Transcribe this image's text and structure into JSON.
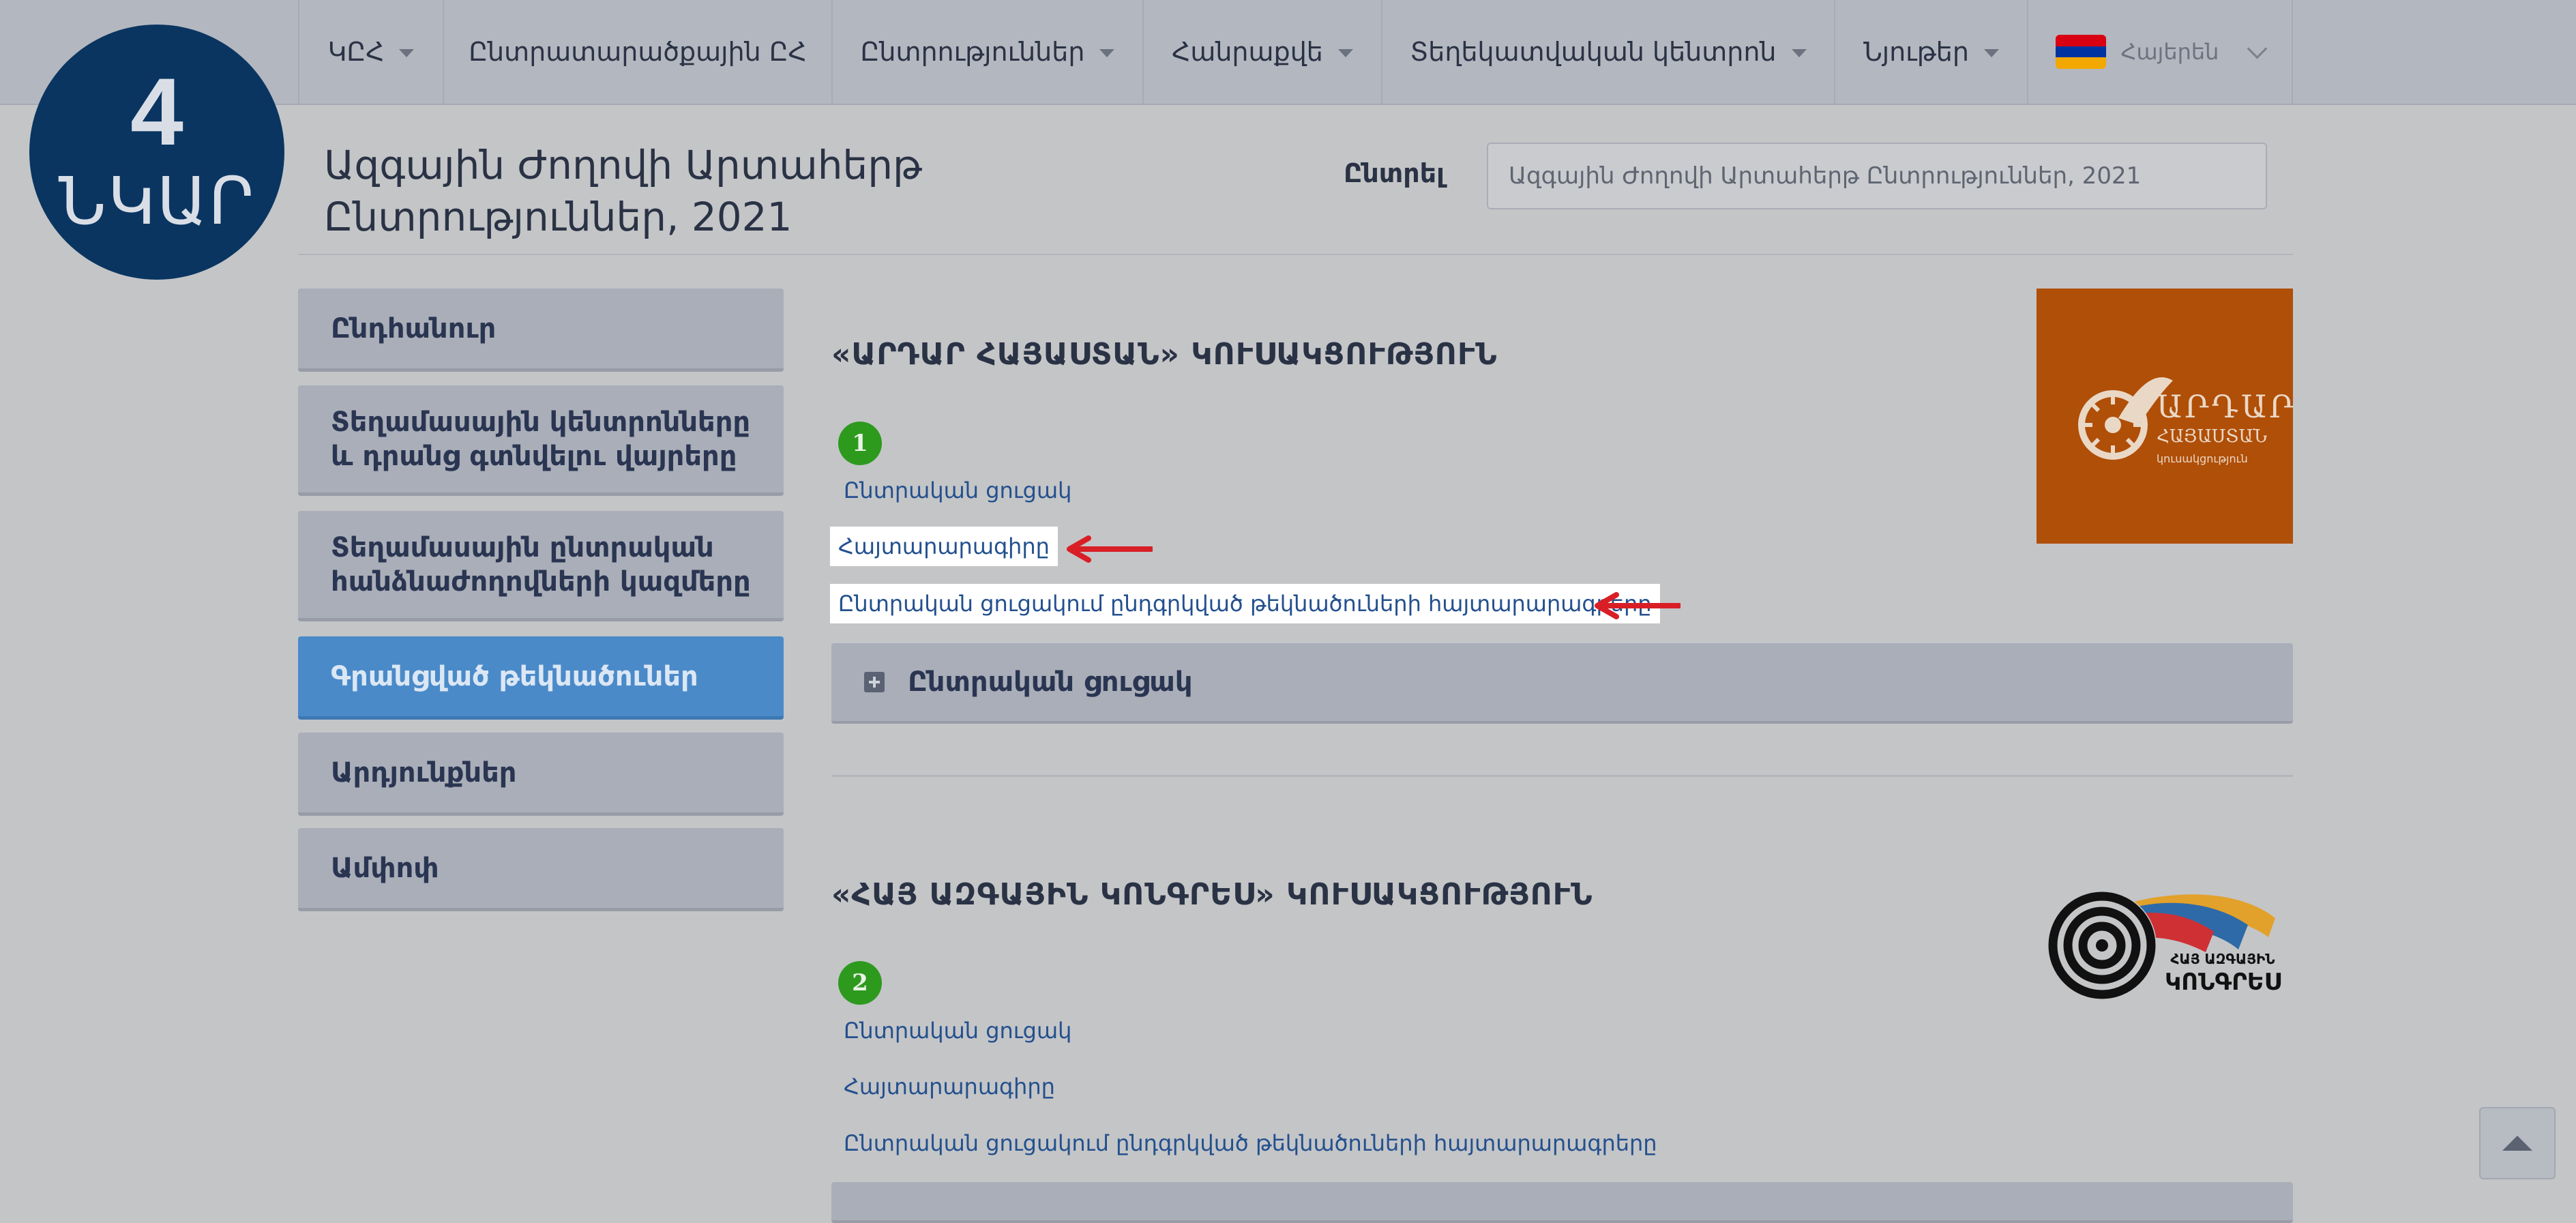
{
  "badge": {
    "number": "4",
    "word": "ՆԿԱՐ"
  },
  "nav": {
    "items": [
      {
        "label": "ԿԸՀ",
        "dropdown": true
      },
      {
        "label": "Ընտրատարածքային ԸՀ",
        "dropdown": false
      },
      {
        "label": "Ընտրություններ",
        "dropdown": true
      },
      {
        "label": "Հանրաքվե",
        "dropdown": true
      },
      {
        "label": "Տեղեկատվական կենտրոն",
        "dropdown": true
      },
      {
        "label": "Նյութեր",
        "dropdown": true
      }
    ],
    "language": {
      "label": "Հայերեն",
      "flag_colors": [
        "#d90012",
        "#0033a0",
        "#f2a800"
      ]
    }
  },
  "header": {
    "title": "Ազգային Ժողովի Արտահերթ Ընտրություններ, 2021",
    "select_label": "Ընտրել",
    "select_value": "Ազգային Ժողովի Արտահերթ Ընտրություններ, 2021"
  },
  "sidebar": {
    "items": [
      {
        "label": "Ընդհանուր",
        "active": false
      },
      {
        "label": "Տեղամասային կենտրոնները և դրանց գտնվելու վայրերը",
        "active": false
      },
      {
        "label": "Տեղամասային ընտրական հանձնաժողովների կազմերը",
        "active": false
      },
      {
        "label": "Գրանցված թեկնածուներ",
        "active": true
      },
      {
        "label": "Արդյունքներ",
        "active": false
      },
      {
        "label": "Ամփոփ",
        "active": false
      }
    ]
  },
  "parties": [
    {
      "title": "«ԱՐԴԱՐ ՀԱՅԱՍՏԱՆ» ԿՈՒՍԱԿՑՈՒԹՅՈՒՆ",
      "number": "1",
      "links": [
        "Ընտրական ցուցակ",
        "Հայտարարագիրը",
        "Ընտրական ցուցակում ընդգրկված թեկնածուների հայտարարագրերը"
      ],
      "accordion_label": "Ընտրական ցուցակ",
      "logo_text": {
        "line1": "ԱՐԴԱՐ",
        "line2": "ՀԱՅԱՍՏԱՆ",
        "line3": "կուսակցություն"
      },
      "logo_color": "#b04f08"
    },
    {
      "title": "«ՀԱՅ ԱԶԳԱՅԻՆ ԿՈՆԳՐԵՍ» ԿՈՒՍԱԿՑՈՒԹՅՈՒՆ",
      "number": "2",
      "links": [
        "Ընտրական ցուցակ",
        "Հայտարարագիրը",
        "Ընտրական ցուցակում ընդգրկված թեկնածուների հայտարարագրերը"
      ],
      "logo_text": {
        "line1": "ՀԱՅ ԱԶԳԱՅԻՆ",
        "line2": "ԿՈՆԳՐԵՍ"
      }
    }
  ],
  "colors": {
    "accent": "#4a8ac9",
    "number_badge": "#2d9a1e",
    "annotation_arrow": "#d91f26",
    "link": "#23508e"
  }
}
